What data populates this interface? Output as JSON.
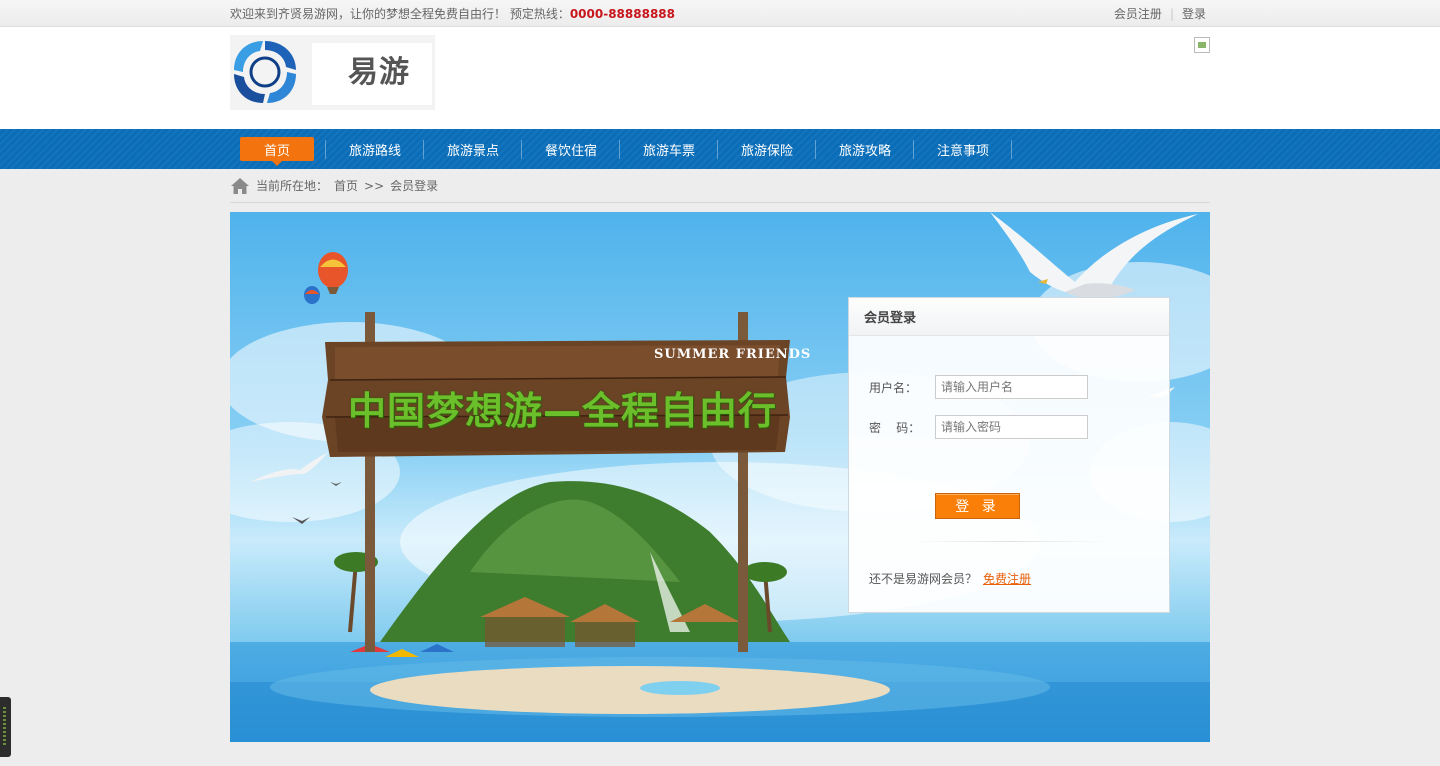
{
  "topbar": {
    "welcome": "欢迎来到齐贤易游网，让你的梦想全程免费自由行！ 预定热线：",
    "hotline": "0000-88888888",
    "register": "会员注册",
    "separator": "|",
    "login": "登录"
  },
  "logo": {
    "text": "易游"
  },
  "nav": {
    "items": [
      {
        "label": "首页",
        "active": true
      },
      {
        "label": "旅游路线"
      },
      {
        "label": "旅游景点"
      },
      {
        "label": "餐饮住宿"
      },
      {
        "label": "旅游车票"
      },
      {
        "label": "旅游保险"
      },
      {
        "label": "旅游攻略"
      },
      {
        "label": "注意事项"
      }
    ]
  },
  "breadcrumb": {
    "prefix": "当前所在地：",
    "home": "首页",
    "sep": ">>",
    "current": "会员登录"
  },
  "banner": {
    "sign_title": "中国梦想游—全程自由行",
    "sign_subtitle": "SUMMER FRIENDS"
  },
  "login_box": {
    "title": "会员登录",
    "username_label": "用户名：",
    "username_placeholder": "请输入用户名",
    "password_label": "密    码：",
    "password_placeholder": "请输入密码",
    "submit_label": "登 录",
    "register_prompt": "还不是易游网会员？",
    "register_link": "免费注册"
  },
  "colors": {
    "nav_bg": "#0a6db8",
    "accent_orange": "#f97f08",
    "hotline_red": "#c8161d",
    "link_orange": "#e8600c"
  },
  "icons": [
    "home-icon",
    "logo-ring-icon",
    "broken-image-icon"
  ]
}
